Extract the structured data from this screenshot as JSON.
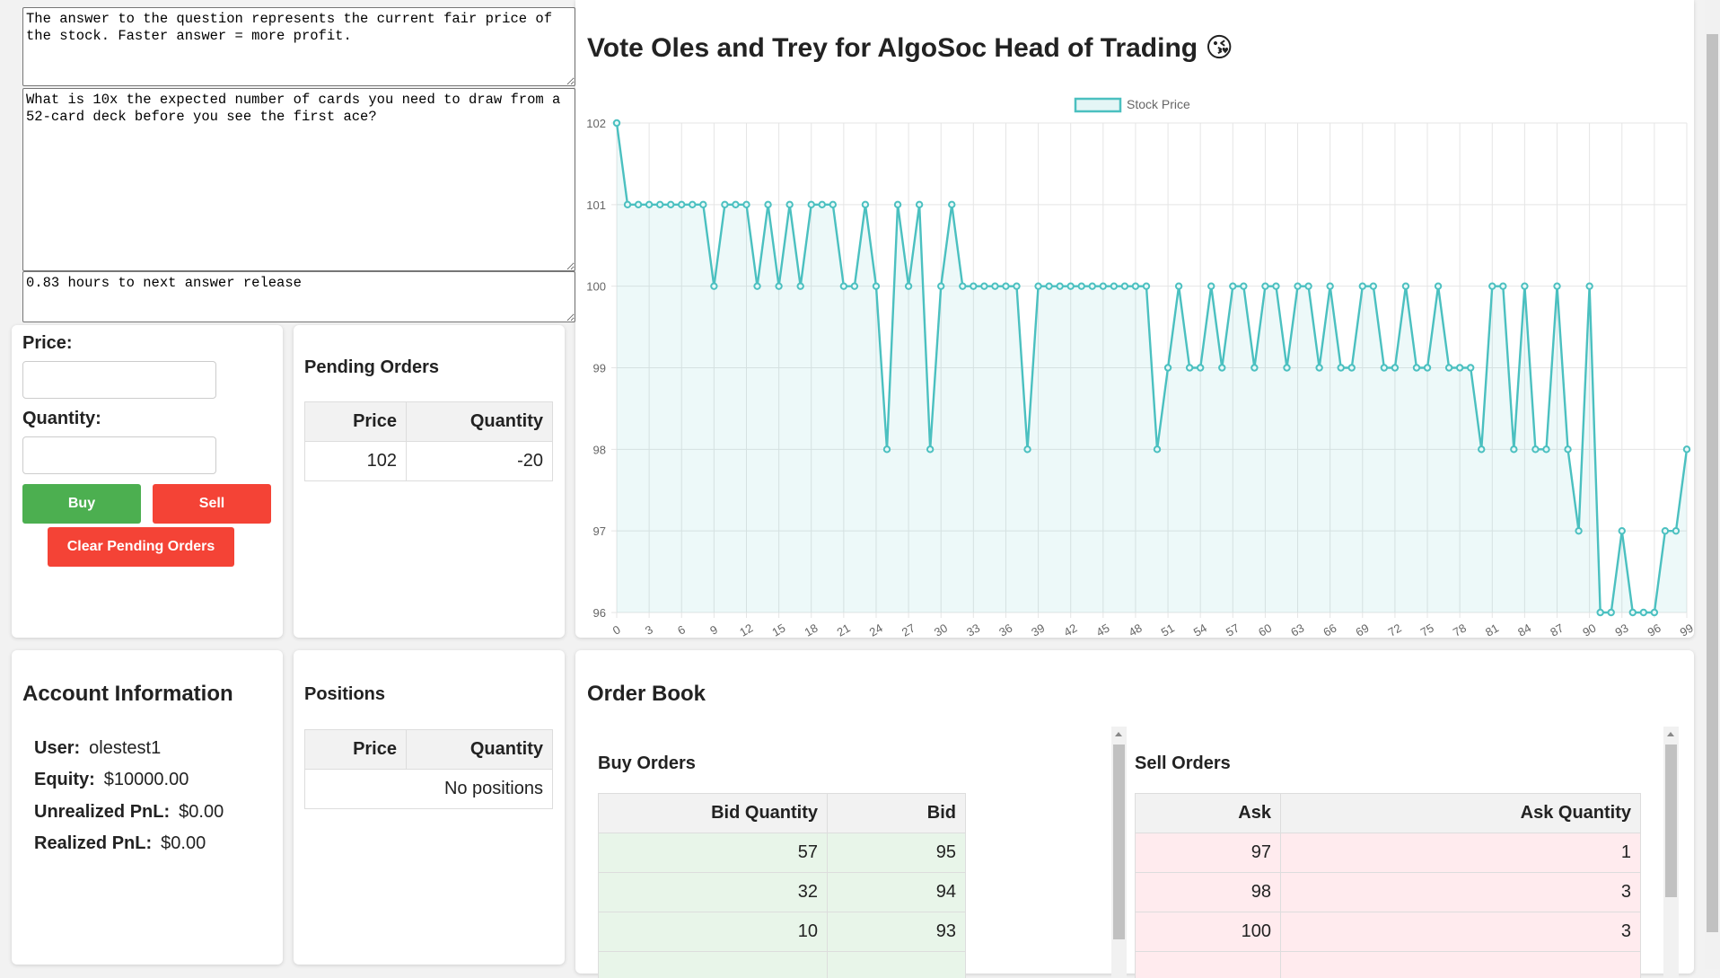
{
  "question_panel": {
    "info_text": "The answer to the question represents the current fair price of the stock. Faster answer = more profit.",
    "question_text": "What is 10x the expected number of cards you need to draw from a 52-card deck before you see the first ace?",
    "timer_text": "0.83 hours to next answer release"
  },
  "order_entry": {
    "price_label": "Price:",
    "quantity_label": "Quantity:",
    "price_value": "",
    "quantity_value": "",
    "buy_label": "Buy",
    "sell_label": "Sell",
    "clear_label": "Clear Pending Orders",
    "colors": {
      "buy": "#4caf50",
      "sell": "#f44336"
    }
  },
  "pending_orders": {
    "title": "Pending Orders",
    "headers": [
      "Price",
      "Quantity"
    ],
    "rows": [
      {
        "price": "102",
        "quantity": "-20"
      }
    ]
  },
  "chart": {
    "title": "Vote Oles and Trey for AlgoSoc Head of Trading 😘"
  },
  "chart_data": {
    "type": "line",
    "title": "Vote Oles and Trey for AlgoSoc Head of Trading 😘",
    "legend": "Stock Price",
    "legend_position": "top",
    "ylim": [
      96,
      102
    ],
    "yticks": [
      96,
      97,
      98,
      99,
      100,
      101,
      102
    ],
    "xticks": [
      0,
      3,
      6,
      9,
      12,
      15,
      18,
      21,
      24,
      27,
      30,
      33,
      36,
      39,
      42,
      45,
      48,
      51,
      54,
      57,
      60,
      63,
      66,
      69,
      72,
      75,
      78,
      81,
      84,
      87,
      90,
      93,
      96,
      99
    ],
    "grid": true,
    "color": "#4bc0c0",
    "fill": "rgba(75,192,192,0.1)",
    "series": [
      {
        "name": "Stock Price",
        "values": [
          102,
          101,
          101,
          101,
          101,
          101,
          101,
          101,
          101,
          100,
          101,
          101,
          101,
          100,
          101,
          100,
          101,
          100,
          101,
          101,
          101,
          100,
          100,
          101,
          100,
          98,
          101,
          100,
          101,
          98,
          100,
          101,
          100,
          100,
          100,
          100,
          100,
          100,
          98,
          100,
          100,
          100,
          100,
          100,
          100,
          100,
          100,
          100,
          100,
          100,
          98,
          99,
          100,
          99,
          99,
          100,
          99,
          100,
          100,
          99,
          100,
          100,
          99,
          100,
          100,
          99,
          100,
          99,
          99,
          100,
          100,
          99,
          99,
          100,
          99,
          99,
          100,
          99,
          99,
          99,
          98,
          100,
          100,
          98,
          100,
          98,
          98,
          100,
          98,
          97,
          100,
          96,
          96,
          97,
          96,
          96,
          96,
          97,
          97,
          98
        ]
      }
    ]
  },
  "account": {
    "title": "Account Information",
    "user_label": "User:",
    "user_value": "olestest1",
    "equity_label": "Equity:",
    "equity_value": "$10000.00",
    "unrealized_label": "Unrealized PnL:",
    "unrealized_value": "$0.00",
    "realized_label": "Realized PnL:",
    "realized_value": "$0.00"
  },
  "positions": {
    "title": "Positions",
    "headers": [
      "Price",
      "Quantity"
    ],
    "empty_text": "No positions"
  },
  "order_book": {
    "title": "Order Book",
    "buy": {
      "title": "Buy Orders",
      "headers": [
        "Bid Quantity",
        "Bid"
      ],
      "rows": [
        [
          "57",
          "95"
        ],
        [
          "32",
          "94"
        ],
        [
          "10",
          "93"
        ]
      ],
      "row_color": "#e8f5e9"
    },
    "sell": {
      "title": "Sell Orders",
      "headers": [
        "Ask",
        "Ask Quantity"
      ],
      "rows": [
        [
          "97",
          "1"
        ],
        [
          "98",
          "3"
        ],
        [
          "100",
          "3"
        ]
      ],
      "row_color": "#ffebee"
    }
  }
}
